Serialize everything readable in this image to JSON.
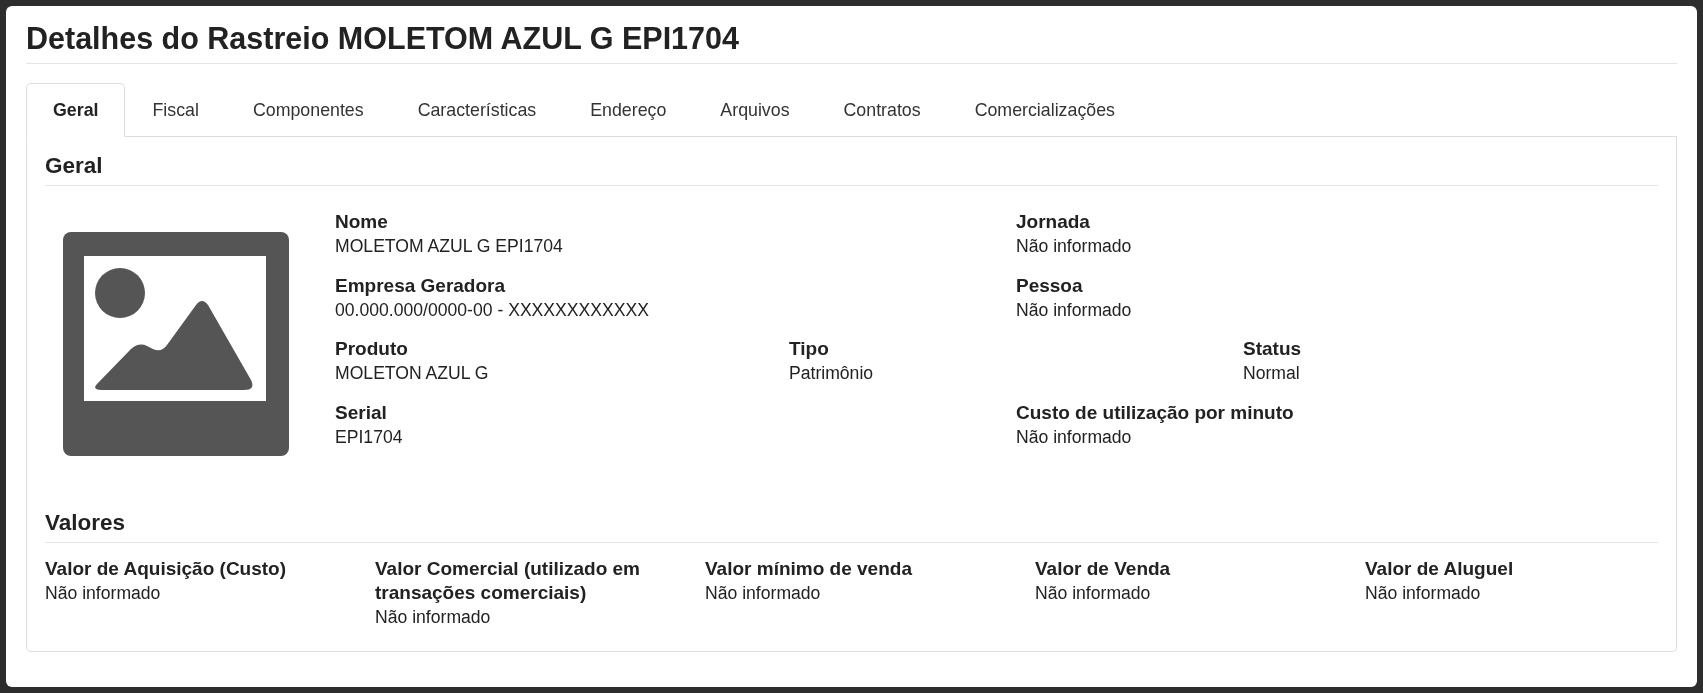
{
  "title": "Detalhes do Rastreio MOLETOM AZUL G EPI1704",
  "tabs": [
    {
      "label": "Geral",
      "selected": true
    },
    {
      "label": "Fiscal",
      "selected": false
    },
    {
      "label": "Componentes",
      "selected": false
    },
    {
      "label": "Características",
      "selected": false
    },
    {
      "label": "Endereço",
      "selected": false
    },
    {
      "label": "Arquivos",
      "selected": false
    },
    {
      "label": "Contratos",
      "selected": false
    },
    {
      "label": "Comercializações",
      "selected": false
    }
  ],
  "geral": {
    "heading": "Geral",
    "rows": [
      {
        "fields": [
          {
            "label": "Nome",
            "value": "MOLETOM AZUL G EPI1704"
          },
          {
            "label": "Jornada",
            "value": "Não informado"
          }
        ]
      },
      {
        "fields": [
          {
            "label": "Empresa Geradora",
            "value": "00.000.000/0000-00 - XXXXXXXXXXXX"
          },
          {
            "label": "Pessoa",
            "value": "Não informado"
          }
        ]
      },
      {
        "fields": [
          {
            "label": "Produto",
            "value": "MOLETON AZUL G"
          },
          {
            "label": "Tipo",
            "value": "Patrimônio"
          },
          {
            "label": "Status",
            "value": "Normal"
          }
        ]
      },
      {
        "fields": [
          {
            "label": "Serial",
            "value": "EPI1704"
          },
          {
            "label": "Custo de utilização por minuto",
            "value": "Não informado"
          }
        ]
      }
    ]
  },
  "valores": {
    "heading": "Valores",
    "fields": [
      {
        "label": "Valor de Aquisição (Custo)",
        "value": "Não informado"
      },
      {
        "label": "Valor Comercial (utilizado em transações comerciais)",
        "value": "Não informado"
      },
      {
        "label": "Valor mínimo de venda",
        "value": "Não informado"
      },
      {
        "label": "Valor de Venda",
        "value": "Não informado"
      },
      {
        "label": "Valor de Aluguel",
        "value": "Não informado"
      }
    ]
  }
}
